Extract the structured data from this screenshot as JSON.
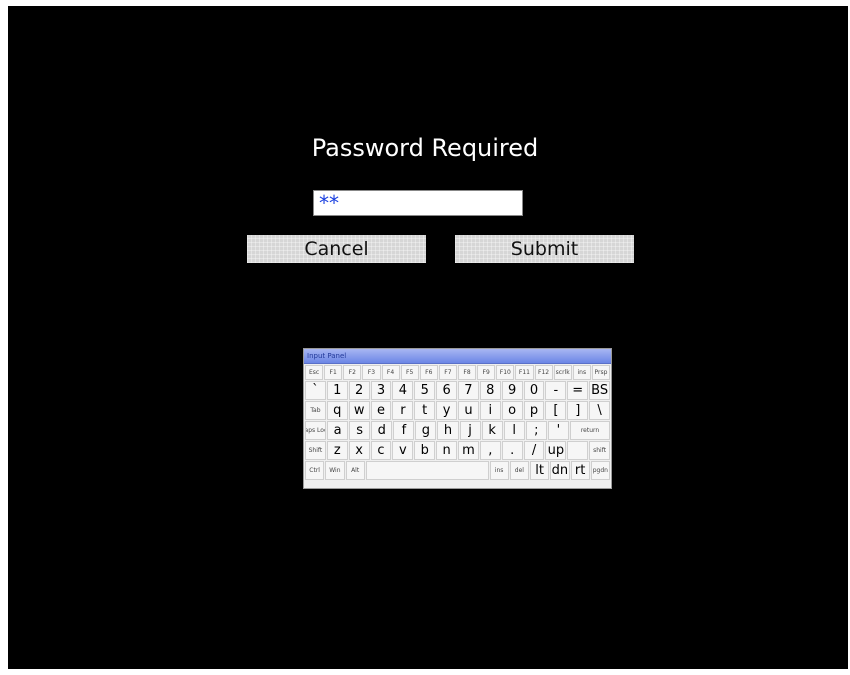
{
  "dialog": {
    "title": "Password Required",
    "password_value": "**",
    "cancel_label": "Cancel",
    "submit_label": "Submit"
  },
  "keyboard": {
    "title": "Input Panel",
    "rows": [
      [
        {
          "label": "Esc",
          "size": "fn"
        },
        {
          "label": "F1",
          "size": "fn"
        },
        {
          "label": "F2",
          "size": "fn"
        },
        {
          "label": "F3",
          "size": "fn"
        },
        {
          "label": "F4",
          "size": "fn"
        },
        {
          "label": "F5",
          "size": "fn"
        },
        {
          "label": "F6",
          "size": "fn"
        },
        {
          "label": "F7",
          "size": "fn"
        },
        {
          "label": "F8",
          "size": "fn"
        },
        {
          "label": "F9",
          "size": "fn"
        },
        {
          "label": "F10",
          "size": "fn"
        },
        {
          "label": "F11",
          "size": "fn"
        },
        {
          "label": "F12",
          "size": "fn"
        },
        {
          "label": "scrlk",
          "size": "fn"
        },
        {
          "label": "ins",
          "size": "fn"
        },
        {
          "label": "Prsp",
          "size": "fn"
        }
      ],
      [
        {
          "label": "`"
        },
        {
          "label": "1"
        },
        {
          "label": "2"
        },
        {
          "label": "3"
        },
        {
          "label": "4"
        },
        {
          "label": "5"
        },
        {
          "label": "6"
        },
        {
          "label": "7"
        },
        {
          "label": "8"
        },
        {
          "label": "9"
        },
        {
          "label": "0"
        },
        {
          "label": "-"
        },
        {
          "label": "="
        },
        {
          "label": "BS"
        }
      ],
      [
        {
          "label": "Tab",
          "size": "tiny"
        },
        {
          "label": "q"
        },
        {
          "label": "w"
        },
        {
          "label": "e"
        },
        {
          "label": "r"
        },
        {
          "label": "t"
        },
        {
          "label": "y"
        },
        {
          "label": "u"
        },
        {
          "label": "i"
        },
        {
          "label": "o"
        },
        {
          "label": "p"
        },
        {
          "label": "["
        },
        {
          "label": "]"
        },
        {
          "label": "\\"
        }
      ],
      [
        {
          "label": "Caps Lock",
          "size": "tiny"
        },
        {
          "label": "a"
        },
        {
          "label": "s"
        },
        {
          "label": "d"
        },
        {
          "label": "f"
        },
        {
          "label": "g"
        },
        {
          "label": "h"
        },
        {
          "label": "j"
        },
        {
          "label": "k"
        },
        {
          "label": "l"
        },
        {
          "label": ";"
        },
        {
          "label": "'"
        },
        {
          "label": "return",
          "size": "tiny",
          "span": "wide2"
        }
      ],
      [
        {
          "label": "Shift",
          "size": "tiny"
        },
        {
          "label": "z"
        },
        {
          "label": "x"
        },
        {
          "label": "c"
        },
        {
          "label": "v"
        },
        {
          "label": "b"
        },
        {
          "label": "n"
        },
        {
          "label": "m"
        },
        {
          "label": ","
        },
        {
          "label": "."
        },
        {
          "label": "/"
        },
        {
          "label": "up"
        },
        {
          "label": ""
        },
        {
          "label": "shift",
          "size": "tiny"
        }
      ],
      [
        {
          "label": "Ctrl",
          "size": "tiny"
        },
        {
          "label": "Win",
          "size": "tiny"
        },
        {
          "label": "Alt",
          "size": "tiny"
        },
        {
          "label": "",
          "span": "space"
        },
        {
          "label": "ins",
          "size": "tiny"
        },
        {
          "label": "del",
          "size": "tiny"
        },
        {
          "label": "lt"
        },
        {
          "label": "dn"
        },
        {
          "label": "rt"
        },
        {
          "label": "pgdn",
          "size": "tiny"
        }
      ]
    ]
  }
}
